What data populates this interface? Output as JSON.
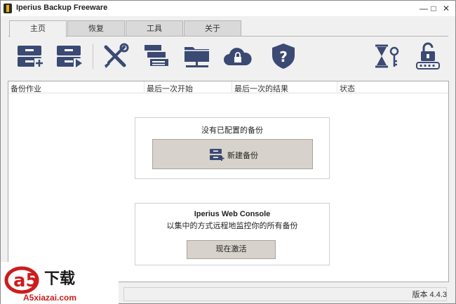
{
  "window": {
    "title": "Iperius Backup   Freeware",
    "controls": {
      "minimize": "—",
      "maximize": "□",
      "close": "✕"
    }
  },
  "tabs": [
    {
      "label": "主页",
      "active": true
    },
    {
      "label": "恢复",
      "active": false
    },
    {
      "label": "工具",
      "active": false
    },
    {
      "label": "关于",
      "active": false
    }
  ],
  "toolbar": {
    "icons": [
      "new-backup-icon",
      "run-backup-icon",
      "tools-icon",
      "list-icon",
      "network-folder-icon",
      "cloud-lock-icon",
      "help-shield-icon",
      "hourglass-key-icon",
      "password-lock-icon"
    ]
  },
  "list": {
    "columns": [
      "备份作业",
      "最后一次开始",
      "最后一次的结果",
      "状态"
    ]
  },
  "empty_state": {
    "title": "没有已配置的备份",
    "new_backup_label": "新建备份"
  },
  "console": {
    "title": "Iperius Web Console",
    "subtitle": "以集中的方式远程地监控你的所有备份",
    "activate_label": "现在激活"
  },
  "status": {
    "version": "版本 4.4.3"
  },
  "watermark": {
    "logo": "a5",
    "main": "下载",
    "url": "A5xiazai.com"
  },
  "colors": {
    "accent": "#3b4a73",
    "button_bg": "#d7d2cb",
    "watermark_red": "#cc1c1c"
  }
}
